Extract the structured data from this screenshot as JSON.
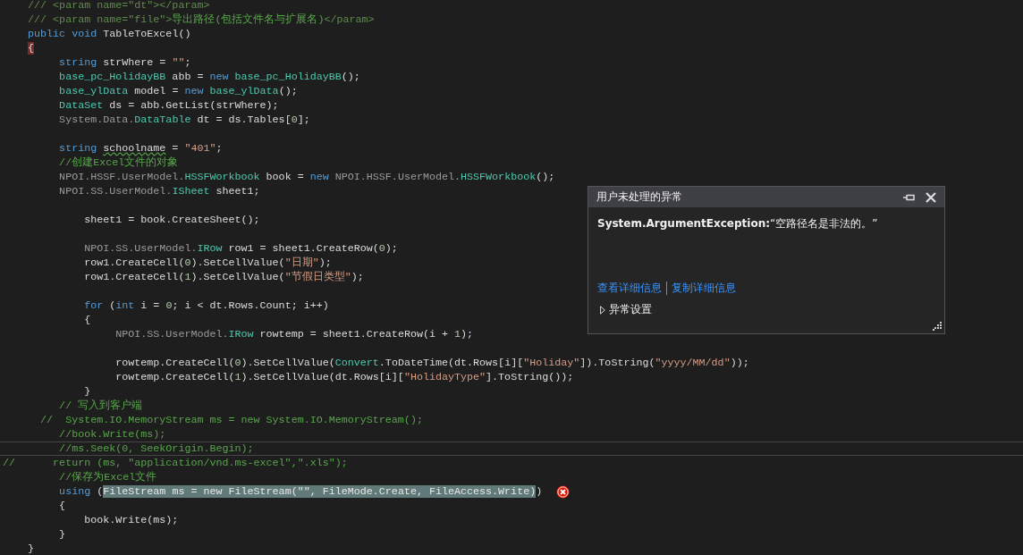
{
  "editor": {
    "lines": [
      {
        "current": false,
        "error": false,
        "tokens": [
          {
            "t": "    /// <param name=\"dt\"></param>",
            "kind": "doc"
          }
        ]
      },
      {
        "current": false,
        "error": false,
        "tokens": [
          {
            "t": "    /// <param name=\"file\">",
            "kind": "doc"
          },
          {
            "t": "导出路径(包括文件名与扩展名)",
            "kind": "comment"
          },
          {
            "t": "</param>",
            "kind": "doc"
          }
        ]
      },
      {
        "current": false,
        "error": false,
        "tokens": [
          {
            "t": "    public void",
            "kind": "keyword"
          },
          {
            "t": " TableToExcel()",
            "kind": "plain"
          }
        ]
      },
      {
        "current": false,
        "error": false,
        "tokens": [
          {
            "t": "    {",
            "kind": "brace_match"
          }
        ]
      },
      {
        "current": false,
        "error": false,
        "tokens": [
          {
            "t": "         string",
            "kind": "keyword"
          },
          {
            "t": " strWhere = ",
            "kind": "plain"
          },
          {
            "t": "\"\"",
            "kind": "string"
          },
          {
            "t": ";",
            "kind": "plain"
          }
        ]
      },
      {
        "current": false,
        "error": false,
        "tokens": [
          {
            "t": "         base_pc_HolidayBB",
            "kind": "type"
          },
          {
            "t": " abb = ",
            "kind": "plain"
          },
          {
            "t": "new",
            "kind": "keyword"
          },
          {
            "t": " base_pc_HolidayBB",
            "kind": "type"
          },
          {
            "t": "();",
            "kind": "plain"
          }
        ]
      },
      {
        "current": false,
        "error": false,
        "tokens": [
          {
            "t": "         base_ylData",
            "kind": "type"
          },
          {
            "t": " model = ",
            "kind": "plain"
          },
          {
            "t": "new",
            "kind": "keyword"
          },
          {
            "t": " base_ylData",
            "kind": "type"
          },
          {
            "t": "();",
            "kind": "plain"
          }
        ]
      },
      {
        "current": false,
        "error": false,
        "tokens": [
          {
            "t": "         DataSet",
            "kind": "type"
          },
          {
            "t": " ds = abb.GetList(strWhere);",
            "kind": "plain"
          }
        ]
      },
      {
        "current": false,
        "error": false,
        "tokens": [
          {
            "t": "         System.Data.",
            "kind": "ns"
          },
          {
            "t": "DataTable",
            "kind": "type"
          },
          {
            "t": " dt = ds.Tables[",
            "kind": "plain"
          },
          {
            "t": "0",
            "kind": "number"
          },
          {
            "t": "];",
            "kind": "plain"
          }
        ]
      },
      {
        "current": false,
        "error": false
      },
      {
        "current": false,
        "error": false,
        "tokens": [
          {
            "t": "         string ",
            "kind": "keyword"
          },
          {
            "t": "schoolname",
            "kind": "warning"
          },
          {
            "t": " = ",
            "kind": "plain"
          },
          {
            "t": "\"401\"",
            "kind": "string"
          },
          {
            "t": ";",
            "kind": "plain"
          }
        ]
      },
      {
        "current": false,
        "error": false,
        "tokens": [
          {
            "t": "         //创建Excel文件的对象",
            "kind": "comment"
          }
        ]
      },
      {
        "current": false,
        "error": false,
        "tokens": [
          {
            "t": "         NPOI.HSSF.UserModel.",
            "kind": "ns"
          },
          {
            "t": "HSSFWorkbook",
            "kind": "type"
          },
          {
            "t": " book = ",
            "kind": "plain"
          },
          {
            "t": "new",
            "kind": "keyword"
          },
          {
            "t": " NPOI.HSSF.UserModel.",
            "kind": "ns"
          },
          {
            "t": "HSSFWorkbook",
            "kind": "type"
          },
          {
            "t": "();",
            "kind": "plain"
          }
        ]
      },
      {
        "current": false,
        "error": false,
        "tokens": [
          {
            "t": "         NPOI.SS.UserModel.",
            "kind": "ns"
          },
          {
            "t": "ISheet",
            "kind": "type"
          },
          {
            "t": " sheet1;",
            "kind": "plain"
          }
        ]
      },
      {
        "current": false,
        "error": false
      },
      {
        "current": false,
        "error": false,
        "tokens": [
          {
            "t": "             sheet1 = book.CreateSheet();",
            "kind": "plain"
          }
        ]
      },
      {
        "current": false,
        "error": false
      },
      {
        "current": false,
        "error": false,
        "tokens": [
          {
            "t": "             NPOI.SS.UserModel.",
            "kind": "ns"
          },
          {
            "t": "IRow",
            "kind": "type"
          },
          {
            "t": " row1 = sheet1.CreateRow(",
            "kind": "plain"
          },
          {
            "t": "0",
            "kind": "number"
          },
          {
            "t": ");",
            "kind": "plain"
          }
        ]
      },
      {
        "current": false,
        "error": false,
        "tokens": [
          {
            "t": "             row1.CreateCell(",
            "kind": "plain"
          },
          {
            "t": "0",
            "kind": "number"
          },
          {
            "t": ").SetCellValue(",
            "kind": "plain"
          },
          {
            "t": "\"日期\"",
            "kind": "string"
          },
          {
            "t": ");",
            "kind": "plain"
          }
        ]
      },
      {
        "current": false,
        "error": false,
        "tokens": [
          {
            "t": "             row1.CreateCell(",
            "kind": "plain"
          },
          {
            "t": "1",
            "kind": "number"
          },
          {
            "t": ").SetCellValue(",
            "kind": "plain"
          },
          {
            "t": "\"节假日类型\"",
            "kind": "string"
          },
          {
            "t": ");",
            "kind": "plain"
          }
        ]
      },
      {
        "current": false,
        "error": false
      },
      {
        "current": false,
        "error": false,
        "tokens": [
          {
            "t": "             for",
            "kind": "keyword"
          },
          {
            "t": " (",
            "kind": "plain"
          },
          {
            "t": "int",
            "kind": "keyword"
          },
          {
            "t": " i = ",
            "kind": "plain"
          },
          {
            "t": "0",
            "kind": "number"
          },
          {
            "t": "; i < dt.Rows.Count; i++)",
            "kind": "plain"
          }
        ]
      },
      {
        "current": false,
        "error": false,
        "tokens": [
          {
            "t": "             {",
            "kind": "plain"
          }
        ]
      },
      {
        "current": false,
        "error": false,
        "tokens": [
          {
            "t": "                  NPOI.SS.UserModel.",
            "kind": "ns"
          },
          {
            "t": "IRow",
            "kind": "type"
          },
          {
            "t": " rowtemp = sheet1.CreateRow(i + ",
            "kind": "plain"
          },
          {
            "t": "1",
            "kind": "number"
          },
          {
            "t": ");",
            "kind": "plain"
          }
        ]
      },
      {
        "current": false,
        "error": false
      },
      {
        "current": false,
        "error": false,
        "tokens": [
          {
            "t": "                  rowtemp.CreateCell(",
            "kind": "plain"
          },
          {
            "t": "0",
            "kind": "number"
          },
          {
            "t": ").SetCellValue(",
            "kind": "plain"
          },
          {
            "t": "Convert",
            "kind": "type"
          },
          {
            "t": ".ToDateTime(dt.Rows[i][",
            "kind": "plain"
          },
          {
            "t": "\"Holiday\"",
            "kind": "string"
          },
          {
            "t": "]).ToString(",
            "kind": "plain"
          },
          {
            "t": "\"yyyy/MM/dd\"",
            "kind": "string"
          },
          {
            "t": "));",
            "kind": "plain"
          }
        ]
      },
      {
        "current": false,
        "error": false,
        "tokens": [
          {
            "t": "                  rowtemp.CreateCell(",
            "kind": "plain"
          },
          {
            "t": "1",
            "kind": "number"
          },
          {
            "t": ").SetCellValue(dt.Rows[i][",
            "kind": "plain"
          },
          {
            "t": "\"HolidayType\"",
            "kind": "string"
          },
          {
            "t": "].ToString());",
            "kind": "plain"
          }
        ]
      },
      {
        "current": false,
        "error": false,
        "tokens": [
          {
            "t": "             }",
            "kind": "plain"
          }
        ]
      },
      {
        "current": false,
        "error": false,
        "tokens": [
          {
            "t": "         // 写入到客户端",
            "kind": "comment"
          }
        ]
      },
      {
        "current": false,
        "error": false,
        "tokens": [
          {
            "t": "      //  System.IO.MemoryStream ms = new System.IO.MemoryStream();",
            "kind": "comment"
          }
        ]
      },
      {
        "current": false,
        "error": false,
        "tokens": [
          {
            "t": "         //book.Write(ms);",
            "kind": "comment"
          }
        ]
      },
      {
        "current": true,
        "error": false,
        "tokens": [
          {
            "t": "         //ms.Seek(0, SeekOrigin.Begin);",
            "kind": "comment"
          }
        ]
      },
      {
        "current": false,
        "error": false,
        "tokens": [
          {
            "t": "//      return (ms, \"application/vnd.ms-excel\",\".xls\");",
            "kind": "comment"
          }
        ]
      },
      {
        "current": false,
        "error": false,
        "tokens": [
          {
            "t": "         //保存为Excel文件",
            "kind": "comment"
          }
        ]
      },
      {
        "current": false,
        "error": true,
        "tokens": [
          {
            "t": "         using",
            "kind": "keyword"
          },
          {
            "t": " (",
            "kind": "plain"
          },
          {
            "t": "FileStream ms = new FileStream(\"\", FileMode.Create, FileAccess.Write)",
            "kind": "selection"
          },
          {
            "t": ")",
            "kind": "plain"
          }
        ]
      },
      {
        "current": false,
        "error": false,
        "tokens": [
          {
            "t": "         {",
            "kind": "plain"
          }
        ]
      },
      {
        "current": false,
        "error": false,
        "tokens": [
          {
            "t": "             book.Write(ms);",
            "kind": "plain"
          }
        ]
      },
      {
        "current": false,
        "error": false,
        "tokens": [
          {
            "t": "         }",
            "kind": "plain"
          }
        ]
      },
      {
        "current": false,
        "error": false,
        "tokens": [
          {
            "t": "    }",
            "kind": "plain"
          }
        ]
      }
    ]
  },
  "exception_popup": {
    "title": "用户未处理的异常",
    "message": "**System.ArgumentException:**“空路径名是非法的。”",
    "links": [
      "查看详细信息",
      "复制详细信息"
    ],
    "settings": {
      "label": "异常设置",
      "expanded": false
    }
  }
}
